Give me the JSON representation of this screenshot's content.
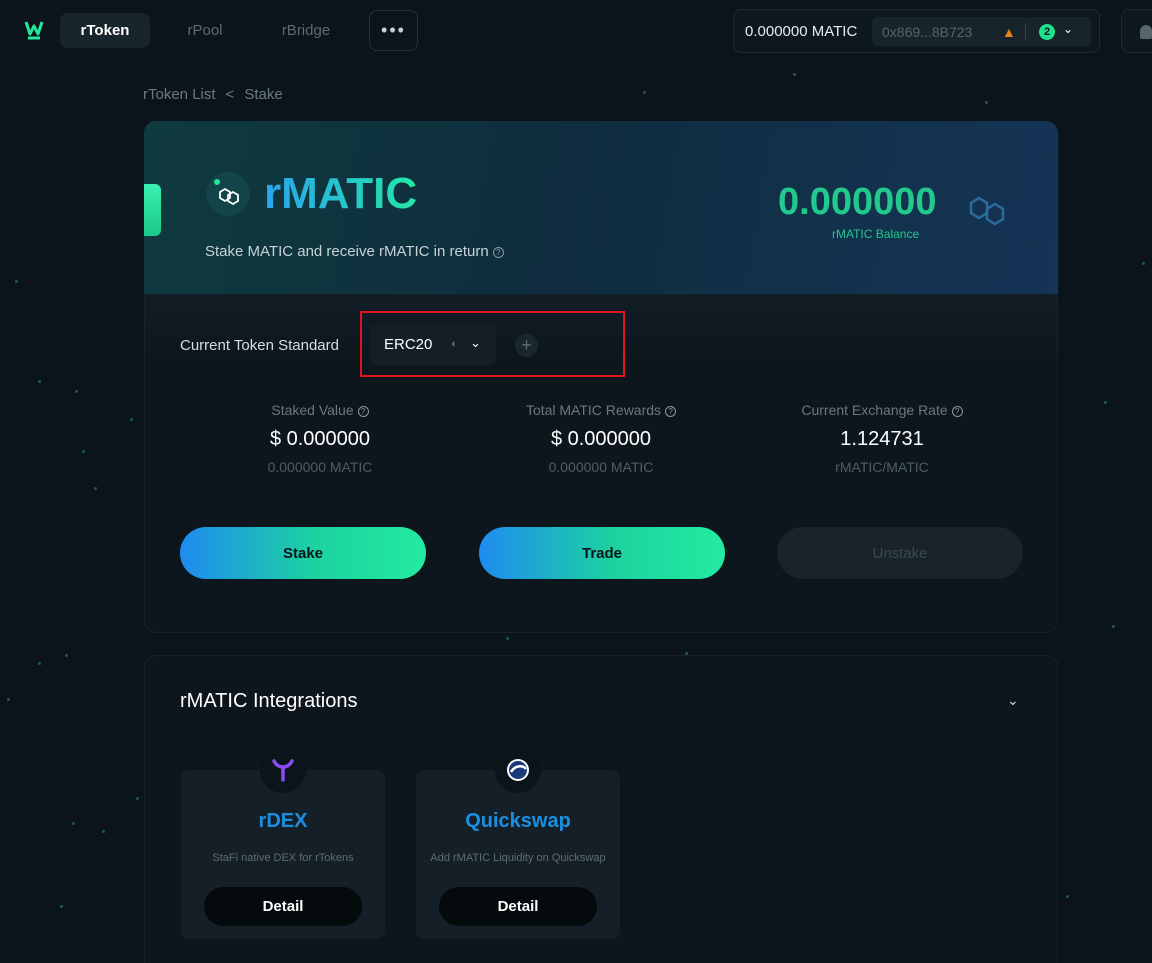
{
  "nav": {
    "tabs": [
      {
        "label": "rToken",
        "active": true
      },
      {
        "label": "rPool",
        "active": false
      },
      {
        "label": "rBridge",
        "active": false
      }
    ],
    "more_label": "•••"
  },
  "wallet": {
    "balance": "0.000000 MATIC",
    "address": "0x869...8B723",
    "network_count": "2"
  },
  "breadcrumb": {
    "parent": "rToken List",
    "separator": "<",
    "current": "Stake"
  },
  "hero": {
    "title": "rMATIC",
    "description": "Stake MATIC and receive rMATIC in return",
    "balance": "0.000000",
    "balance_label": "rMATIC Balance"
  },
  "token_standard": {
    "label": "Current Token Standard",
    "selected": "ERC20"
  },
  "stats": [
    {
      "label": "Staked Value",
      "value": "$ 0.000000",
      "sub": "0.000000 MATIC"
    },
    {
      "label": "Total MATIC Rewards",
      "value": "$ 0.000000",
      "sub": "0.000000 MATIC"
    },
    {
      "label": "Current Exchange Rate",
      "value": "1.124731",
      "sub": "rMATIC/MATIC"
    }
  ],
  "actions": {
    "stake": "Stake",
    "trade": "Trade",
    "unstake": "Unstake"
  },
  "integrations": {
    "title": "rMATIC Integrations",
    "cards": [
      {
        "name": "rDEX",
        "description": "StaFi native DEX for rTokens",
        "button": "Detail",
        "color": "#1a8fe0"
      },
      {
        "name": "Quickswap",
        "description": "Add rMATIC Liquidity on Quickswap",
        "button": "Detail",
        "color": "#1a8fe0"
      }
    ]
  },
  "colors": {
    "accent_green": "#22c98d",
    "accent_blue": "#1f8bf0",
    "highlight": "#e0141e"
  }
}
